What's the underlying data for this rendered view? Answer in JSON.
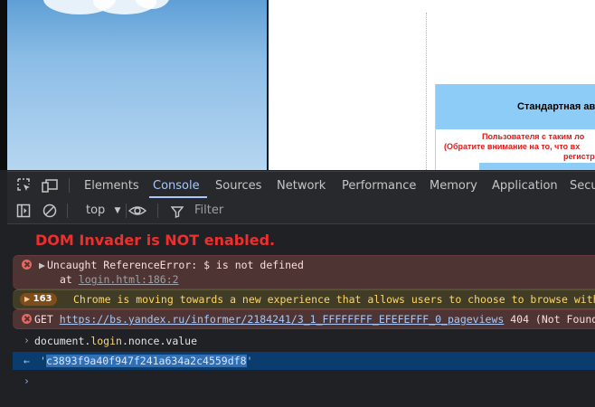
{
  "page": {
    "dialog_title": "Стандартная ав",
    "error_lines": [
      "Пользователя с таким ло",
      "(Обратите внимание на то, что вх",
      "регистр"
    ]
  },
  "devtools": {
    "tabs": [
      "Elements",
      "Console",
      "Sources",
      "Network",
      "Performance",
      "Memory",
      "Application",
      "Secu"
    ],
    "active_tab": "Console",
    "context_selector": "top",
    "filter_placeholder": "Filter",
    "icons": [
      "inspect-element-icon",
      "device-toolbar-icon",
      "sidebar-toggle-icon",
      "clear-console-icon",
      "dropdown-arrow-icon",
      "live-expression-eye-icon",
      "filter-icon"
    ]
  },
  "console": {
    "banner": "DOM Invader is NOT enabled.",
    "error1": {
      "message": "Uncaught ReferenceError: $ is not defined",
      "at_prefix": "at ",
      "location": "login.html:186:2"
    },
    "warning": {
      "count": "163",
      "message": "Chrome is moving towards a new experience that allows users to choose to browse with"
    },
    "error2": {
      "method": "GET",
      "url": "https://bs.yandex.ru/informer/2184241/3_1_FFFFFFFF_EFEFEFFF_0_pageviews",
      "status": "404 (Not Found"
    },
    "command": {
      "object": "document.",
      "property": "login",
      "rest": ".nonce.value"
    },
    "result": {
      "open_quote": "'",
      "value": "c3893f9a40f947f241a634a2c4559df8",
      "close_quote": "'"
    }
  },
  "colors": {
    "accent": "#a8c7fa",
    "error_text": "#e46962",
    "warning_text": "#ffd666",
    "banner": "#f32c2c",
    "result_bg": "#0a3d6e"
  }
}
